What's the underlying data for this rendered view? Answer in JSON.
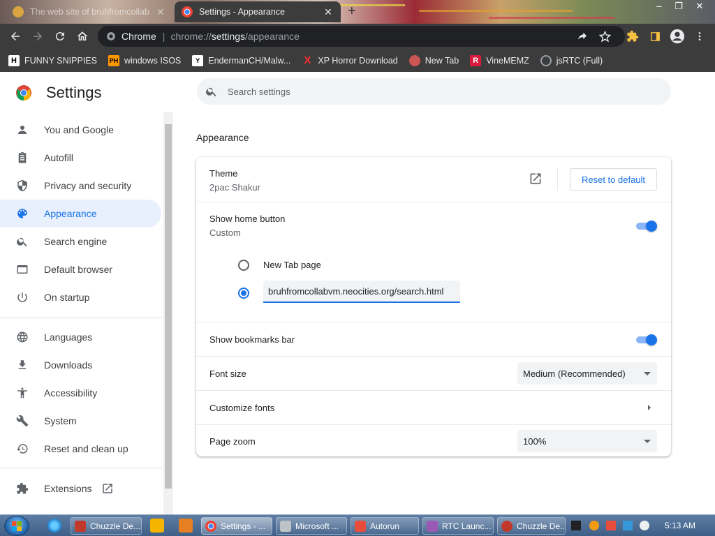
{
  "browser": {
    "tabs": [
      {
        "title": "The web site of bruhfromcollab",
        "active": false
      },
      {
        "title": "Settings - Appearance",
        "active": true
      }
    ],
    "omnibox": {
      "site": "Chrome",
      "url_prefix": "chrome://",
      "url_host": "settings",
      "url_path": "/appearance"
    },
    "bookmarks": [
      {
        "label": "FUNNY SNIPPIES",
        "icon": "H-icon"
      },
      {
        "label": "windows ISOS",
        "icon": "ph-icon"
      },
      {
        "label": "EndermanCH/Malw...",
        "icon": "y-icon"
      },
      {
        "label": "XP Horror Download",
        "icon": "x-icon"
      },
      {
        "label": "New Tab",
        "icon": "avatar-icon"
      },
      {
        "label": "VineMEMZ",
        "icon": "r-icon"
      },
      {
        "label": "jsRTC (Full)",
        "icon": "globe-icon"
      }
    ]
  },
  "settings": {
    "title": "Settings",
    "search_placeholder": "Search settings",
    "nav": [
      {
        "label": "You and Google",
        "icon": "person-icon"
      },
      {
        "label": "Autofill",
        "icon": "clipboard-icon"
      },
      {
        "label": "Privacy and security",
        "icon": "shield-icon"
      },
      {
        "label": "Appearance",
        "icon": "palette-icon",
        "selected": true
      },
      {
        "label": "Search engine",
        "icon": "search-icon"
      },
      {
        "label": "Default browser",
        "icon": "browser-icon"
      },
      {
        "label": "On startup",
        "icon": "power-icon"
      },
      {
        "label": "Languages",
        "icon": "globe-icon"
      },
      {
        "label": "Downloads",
        "icon": "download-icon"
      },
      {
        "label": "Accessibility",
        "icon": "accessibility-icon"
      },
      {
        "label": "System",
        "icon": "wrench-icon"
      },
      {
        "label": "Reset and clean up",
        "icon": "history-icon"
      },
      {
        "label": "Extensions",
        "icon": "puzzle-icon"
      }
    ],
    "section_title": "Appearance",
    "theme": {
      "label": "Theme",
      "value": "2pac Shakur",
      "reset_label": "Reset to default"
    },
    "home_button": {
      "label": "Show home button",
      "sub": "Custom",
      "enabled": true,
      "option_newtab": "New Tab page",
      "custom_url": "bruhfromcollabvm.neocities.org/search.html",
      "selected": "custom"
    },
    "bookmarks_bar": {
      "label": "Show bookmarks bar",
      "enabled": true
    },
    "font_size": {
      "label": "Font size",
      "value": "Medium (Recommended)"
    },
    "customize_fonts": {
      "label": "Customize fonts"
    },
    "page_zoom": {
      "label": "Page zoom",
      "value": "100%"
    }
  },
  "taskbar": {
    "items": [
      {
        "label": "Chuzzle De...",
        "color": "#c0392b"
      },
      {
        "label": "Settings - ...",
        "color": "#4285f4",
        "active": true
      },
      {
        "label": "Microsoft ...",
        "color": "#7f8c8d"
      },
      {
        "label": "Autorun",
        "color": "#e74c3c"
      },
      {
        "label": "RTC Launc...",
        "color": "#9b59b6"
      },
      {
        "label": "Chuzzle De...",
        "color": "#c0392b"
      }
    ],
    "clock": "5:13 AM"
  }
}
